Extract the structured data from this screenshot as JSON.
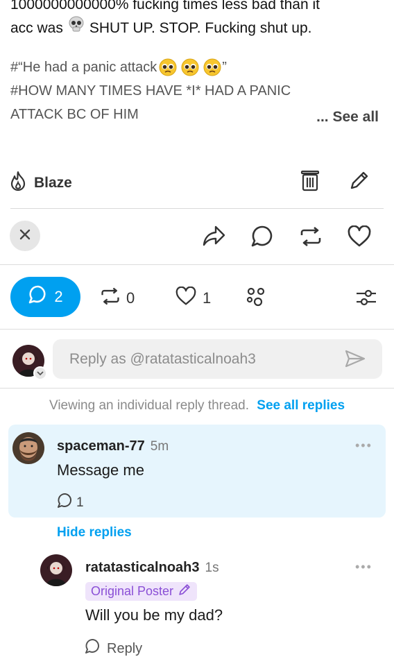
{
  "post": {
    "line0": "1000000000000% fucking times less bad than it",
    "line1_prefix": "acc was",
    "line1_suffix": "SHUT UP. STOP. Fucking shut up.",
    "tag1_prefix": "#“He had a panic attack",
    "tag1_suffix": "”",
    "tag2": "#HOW MANY TIMES HAVE *I* HAD A PANIC",
    "tag3": "ATTACK BC OF HIM",
    "see_all": "... See all"
  },
  "actions": {
    "blaze_label": "Blaze"
  },
  "notes": {
    "replies_count": "2",
    "reblogs_count": "0",
    "likes_count": "1"
  },
  "reply_input": {
    "placeholder": "Reply as @ratatasticalnoah3"
  },
  "thread": {
    "viewing_text": "Viewing an individual reply thread.",
    "see_all_replies": "See all replies",
    "hide_replies": "Hide replies"
  },
  "reply1": {
    "username": "spaceman-77",
    "time": "5m",
    "message": "Message me",
    "reply_count": "1",
    "more": "•••"
  },
  "reply2": {
    "username": "ratatasticalnoah3",
    "time": "1s",
    "badge": "Original Poster",
    "message": "Will you be my dad?",
    "reply_label": "Reply",
    "more": "•••"
  },
  "colors": {
    "accent": "#00a0f0",
    "reply_bg": "#e6f5fd",
    "op_badge_bg": "#efe4fb",
    "op_badge_text": "#8a4fd6"
  }
}
